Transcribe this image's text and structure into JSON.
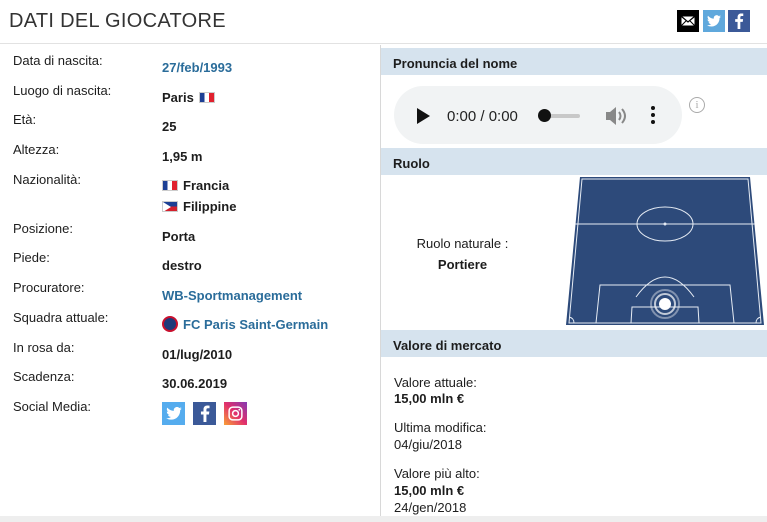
{
  "header": {
    "title": "DATI DEL GIOCATORE"
  },
  "share": {
    "mail_icon": "mail-icon",
    "twitter_icon": "twitter-icon",
    "facebook_icon": "facebook-icon"
  },
  "info": {
    "birth_date_label": "Data di nascita:",
    "birth_date": "27/feb/1993",
    "birth_place_label": "Luogo di nascita:",
    "birth_place": "Paris",
    "age_label": "Età:",
    "age": "25",
    "height_label": "Altezza:",
    "height": "1,95 m",
    "nationality_label": "Nazionalità:",
    "nationality_1": "Francia",
    "nationality_2": "Filippine",
    "position_label": "Posizione:",
    "position": "Porta",
    "foot_label": "Piede:",
    "foot": "destro",
    "agent_label": "Procuratore:",
    "agent": "WB-Sportmanagement",
    "club_label": "Squadra attuale:",
    "club": "FC Paris Saint-Germain",
    "joined_label": "In rosa da:",
    "joined": "01/lug/2010",
    "contract_label": "Scadenza:",
    "contract": "30.06.2019",
    "social_label": "Social Media:"
  },
  "pronunciation": {
    "heading": "Pronuncia del nome",
    "time": "0:00 / 0:00",
    "info_glyph": "i"
  },
  "role": {
    "heading": "Ruolo",
    "natural_label": "Ruolo naturale :",
    "natural_value": "Portiere"
  },
  "market": {
    "heading": "Valore di mercato",
    "current_label": "Valore attuale:",
    "current_value": "15,00 mln €",
    "updated_label": "Ultima modifica:",
    "updated_value": "04/giu/2018",
    "highest_label": "Valore più alto:",
    "highest_value": "15,00 mln €",
    "highest_date": "24/gen/2018"
  },
  "colors": {
    "accent_link": "#2a6c9a",
    "section_head": "#d6e3ee",
    "pitch": "#2d4a7a"
  }
}
